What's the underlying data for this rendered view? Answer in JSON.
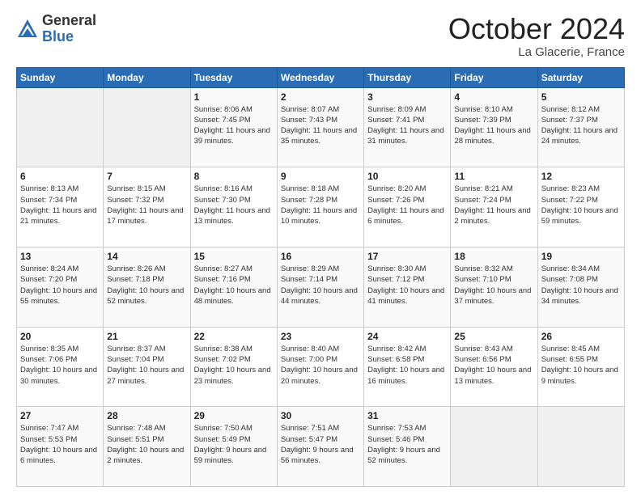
{
  "header": {
    "logo_general": "General",
    "logo_blue": "Blue",
    "month_title": "October 2024",
    "location": "La Glacerie, France"
  },
  "days_of_week": [
    "Sunday",
    "Monday",
    "Tuesday",
    "Wednesday",
    "Thursday",
    "Friday",
    "Saturday"
  ],
  "weeks": [
    [
      {
        "day": "",
        "info": ""
      },
      {
        "day": "",
        "info": ""
      },
      {
        "day": "1",
        "info": "Sunrise: 8:06 AM\nSunset: 7:45 PM\nDaylight: 11 hours and 39 minutes."
      },
      {
        "day": "2",
        "info": "Sunrise: 8:07 AM\nSunset: 7:43 PM\nDaylight: 11 hours and 35 minutes."
      },
      {
        "day": "3",
        "info": "Sunrise: 8:09 AM\nSunset: 7:41 PM\nDaylight: 11 hours and 31 minutes."
      },
      {
        "day": "4",
        "info": "Sunrise: 8:10 AM\nSunset: 7:39 PM\nDaylight: 11 hours and 28 minutes."
      },
      {
        "day": "5",
        "info": "Sunrise: 8:12 AM\nSunset: 7:37 PM\nDaylight: 11 hours and 24 minutes."
      }
    ],
    [
      {
        "day": "6",
        "info": "Sunrise: 8:13 AM\nSunset: 7:34 PM\nDaylight: 11 hours and 21 minutes."
      },
      {
        "day": "7",
        "info": "Sunrise: 8:15 AM\nSunset: 7:32 PM\nDaylight: 11 hours and 17 minutes."
      },
      {
        "day": "8",
        "info": "Sunrise: 8:16 AM\nSunset: 7:30 PM\nDaylight: 11 hours and 13 minutes."
      },
      {
        "day": "9",
        "info": "Sunrise: 8:18 AM\nSunset: 7:28 PM\nDaylight: 11 hours and 10 minutes."
      },
      {
        "day": "10",
        "info": "Sunrise: 8:20 AM\nSunset: 7:26 PM\nDaylight: 11 hours and 6 minutes."
      },
      {
        "day": "11",
        "info": "Sunrise: 8:21 AM\nSunset: 7:24 PM\nDaylight: 11 hours and 2 minutes."
      },
      {
        "day": "12",
        "info": "Sunrise: 8:23 AM\nSunset: 7:22 PM\nDaylight: 10 hours and 59 minutes."
      }
    ],
    [
      {
        "day": "13",
        "info": "Sunrise: 8:24 AM\nSunset: 7:20 PM\nDaylight: 10 hours and 55 minutes."
      },
      {
        "day": "14",
        "info": "Sunrise: 8:26 AM\nSunset: 7:18 PM\nDaylight: 10 hours and 52 minutes."
      },
      {
        "day": "15",
        "info": "Sunrise: 8:27 AM\nSunset: 7:16 PM\nDaylight: 10 hours and 48 minutes."
      },
      {
        "day": "16",
        "info": "Sunrise: 8:29 AM\nSunset: 7:14 PM\nDaylight: 10 hours and 44 minutes."
      },
      {
        "day": "17",
        "info": "Sunrise: 8:30 AM\nSunset: 7:12 PM\nDaylight: 10 hours and 41 minutes."
      },
      {
        "day": "18",
        "info": "Sunrise: 8:32 AM\nSunset: 7:10 PM\nDaylight: 10 hours and 37 minutes."
      },
      {
        "day": "19",
        "info": "Sunrise: 8:34 AM\nSunset: 7:08 PM\nDaylight: 10 hours and 34 minutes."
      }
    ],
    [
      {
        "day": "20",
        "info": "Sunrise: 8:35 AM\nSunset: 7:06 PM\nDaylight: 10 hours and 30 minutes."
      },
      {
        "day": "21",
        "info": "Sunrise: 8:37 AM\nSunset: 7:04 PM\nDaylight: 10 hours and 27 minutes."
      },
      {
        "day": "22",
        "info": "Sunrise: 8:38 AM\nSunset: 7:02 PM\nDaylight: 10 hours and 23 minutes."
      },
      {
        "day": "23",
        "info": "Sunrise: 8:40 AM\nSunset: 7:00 PM\nDaylight: 10 hours and 20 minutes."
      },
      {
        "day": "24",
        "info": "Sunrise: 8:42 AM\nSunset: 6:58 PM\nDaylight: 10 hours and 16 minutes."
      },
      {
        "day": "25",
        "info": "Sunrise: 8:43 AM\nSunset: 6:56 PM\nDaylight: 10 hours and 13 minutes."
      },
      {
        "day": "26",
        "info": "Sunrise: 8:45 AM\nSunset: 6:55 PM\nDaylight: 10 hours and 9 minutes."
      }
    ],
    [
      {
        "day": "27",
        "info": "Sunrise: 7:47 AM\nSunset: 5:53 PM\nDaylight: 10 hours and 6 minutes."
      },
      {
        "day": "28",
        "info": "Sunrise: 7:48 AM\nSunset: 5:51 PM\nDaylight: 10 hours and 2 minutes."
      },
      {
        "day": "29",
        "info": "Sunrise: 7:50 AM\nSunset: 5:49 PM\nDaylight: 9 hours and 59 minutes."
      },
      {
        "day": "30",
        "info": "Sunrise: 7:51 AM\nSunset: 5:47 PM\nDaylight: 9 hours and 56 minutes."
      },
      {
        "day": "31",
        "info": "Sunrise: 7:53 AM\nSunset: 5:46 PM\nDaylight: 9 hours and 52 minutes."
      },
      {
        "day": "",
        "info": ""
      },
      {
        "day": "",
        "info": ""
      }
    ]
  ]
}
